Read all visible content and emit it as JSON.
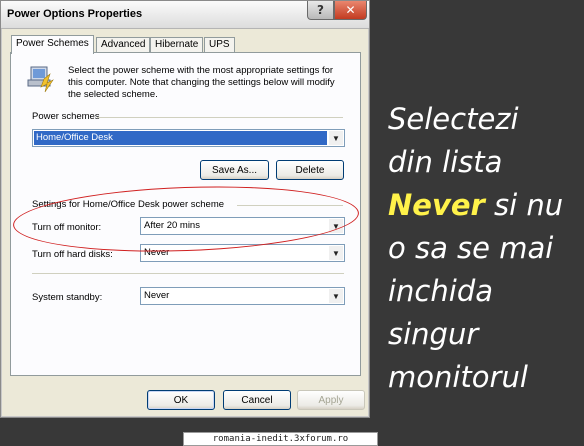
{
  "window": {
    "title": "Power Options Properties",
    "help_glyph": "?",
    "close_glyph": "✕"
  },
  "tabs": [
    {
      "label": "Power Schemes",
      "active": true
    },
    {
      "label": "Advanced",
      "active": false
    },
    {
      "label": "Hibernate",
      "active": false
    },
    {
      "label": "UPS",
      "active": false
    }
  ],
  "description": "Select the power scheme with the most appropriate settings for this computer. Note that changing the settings below will modify the selected scheme.",
  "schemes": {
    "group_label": "Power schemes",
    "selected": "Home/Office Desk",
    "save_as": "Save As...",
    "delete": "Delete"
  },
  "settings": {
    "group_label": "Settings for Home/Office Desk power scheme",
    "monitor_label": "Turn off monitor:",
    "monitor_value": "After 20 mins",
    "disks_label": "Turn off hard disks:",
    "disks_value": "Never",
    "standby_label": "System standby:",
    "standby_value": "Never"
  },
  "buttons": {
    "ok": "OK",
    "cancel": "Cancel",
    "apply": "Apply"
  },
  "caption": {
    "line1": "Selectezi",
    "line2": "din lista",
    "highlight": "Never",
    "line3_rest": " si nu",
    "line4": "o sa se mai",
    "line5": "inchida",
    "line6": "singur",
    "line7": "monitorul"
  },
  "watermark": "romania-inedit.3xforum.ro",
  "colors": {
    "background": "#383838",
    "highlight": "#fff24a",
    "annotation": "#d02020",
    "selection": "#3169c6"
  }
}
